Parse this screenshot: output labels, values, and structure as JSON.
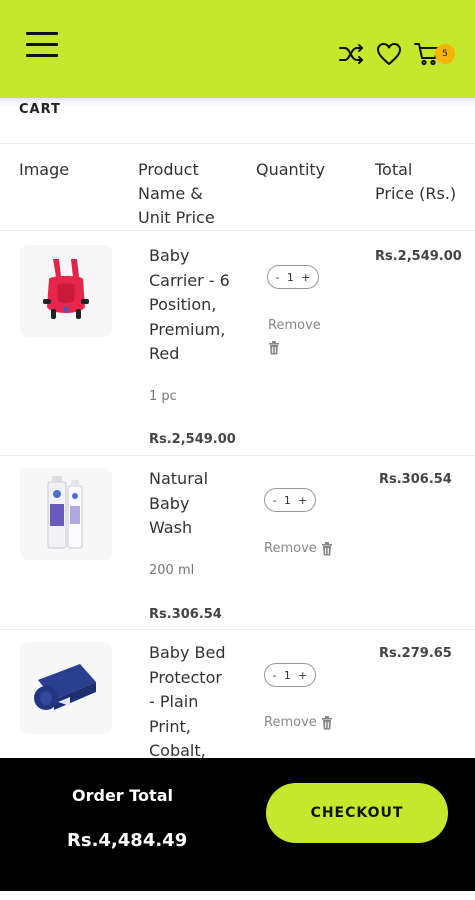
{
  "header": {
    "menu_icon": "hamburger-menu-icon",
    "icons": [
      "shuffle-icon",
      "heart-icon",
      "cart-icon"
    ],
    "cart_count": "5",
    "accent_color": "#c5e82c",
    "badge_color": "#f5b400"
  },
  "page": {
    "title": "CART"
  },
  "table": {
    "headers": {
      "image": "Image",
      "product_line1": "Product",
      "product_line2": "Name &",
      "product_line3": "Unit Price",
      "quantity": "Quantity",
      "total_line1": "Total",
      "total_line2": "Price (Rs.)"
    }
  },
  "items": [
    {
      "name": [
        "Baby",
        "Carrier - 6",
        "Position,",
        "Premium,",
        "Red"
      ],
      "quantity_label": "1 pc",
      "unit_price": "Rs.2,549.00",
      "qty_minus": "-",
      "qty": "1",
      "qty_plus": "+",
      "remove_label": "Remove",
      "total": "Rs.2,549.00",
      "image_icon": "baby-carrier-image"
    },
    {
      "name": [
        "Natural",
        "Baby",
        "Wash"
      ],
      "quantity_label": "200 ml",
      "unit_price": "Rs.306.54",
      "qty_minus": "-",
      "qty": "1",
      "qty_plus": "+",
      "remove_label": "Remove",
      "total": "Rs.306.54",
      "image_icon": "baby-wash-bottle-image"
    },
    {
      "name": [
        "Baby Bed",
        "Protector",
        "- Plain",
        "Print,",
        "Cobalt,"
      ],
      "qty_minus": "-",
      "qty": "1",
      "qty_plus": "+",
      "remove_label": "Remove",
      "total": "Rs.279.65",
      "image_icon": "bed-protector-image"
    }
  ],
  "footer": {
    "order_total_label": "Order Total",
    "order_total_value": "Rs.4,484.49",
    "checkout_label": "CHECKOUT"
  }
}
